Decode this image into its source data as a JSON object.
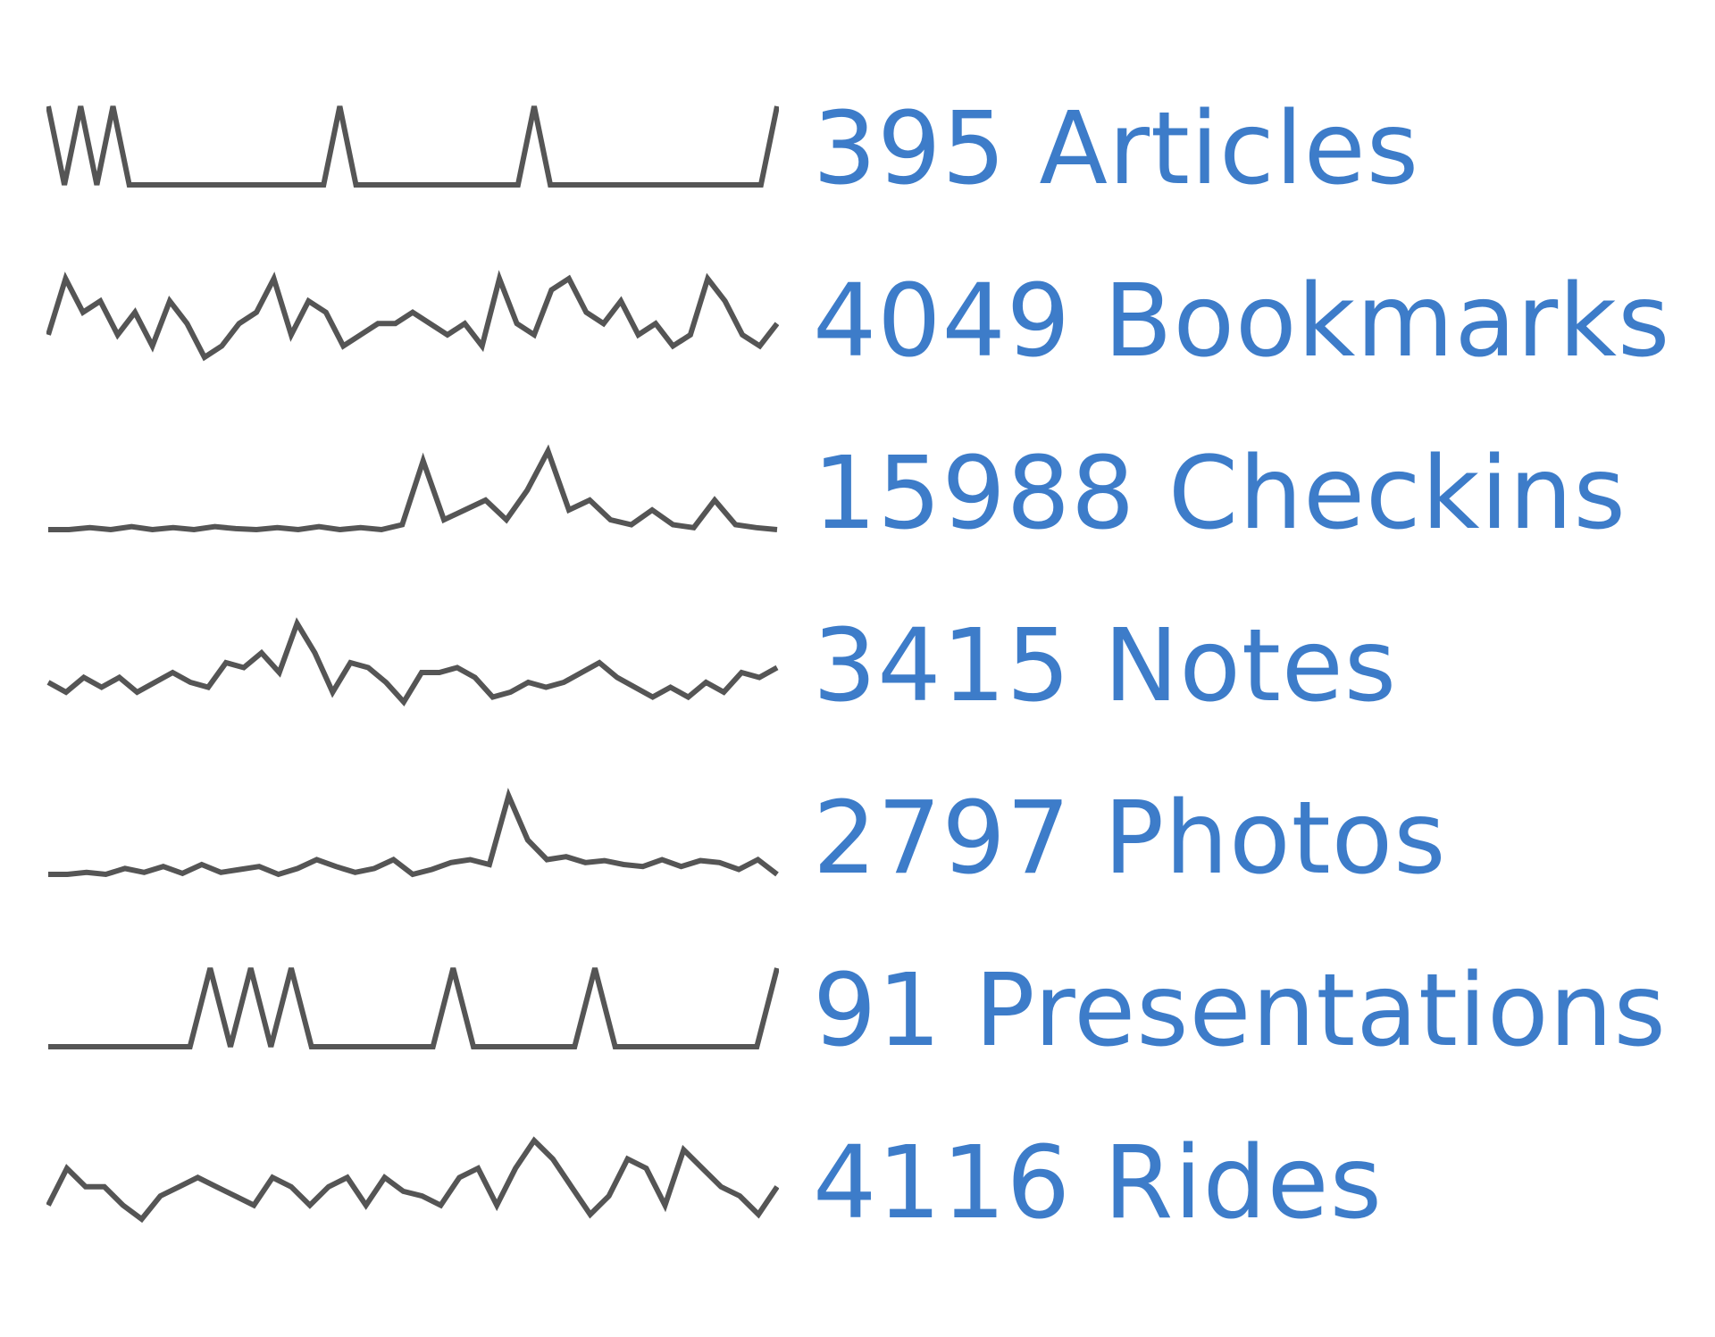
{
  "colors": {
    "link": "#3d7cc9",
    "sparkline": "#555555"
  },
  "stats": [
    {
      "count": "395",
      "label": "Articles"
    },
    {
      "count": "4049",
      "label": "Bookmarks"
    },
    {
      "count": "15988",
      "label": "Checkins"
    },
    {
      "count": "3415",
      "label": "Notes"
    },
    {
      "count": "2797",
      "label": "Photos"
    },
    {
      "count": "91",
      "label": "Presentations"
    },
    {
      "count": "4116",
      "label": "Rides"
    }
  ],
  "chart_data": [
    {
      "type": "line",
      "series": [
        {
          "values": [
            10,
            1,
            10,
            1,
            10,
            1,
            1,
            1,
            1,
            1,
            1,
            1,
            1,
            1,
            1,
            1,
            1,
            1,
            10,
            1,
            1,
            1,
            1,
            1,
            1,
            1,
            1,
            1,
            1,
            1,
            10,
            1,
            1,
            1,
            1,
            1,
            1,
            1,
            1,
            1,
            1,
            1,
            1,
            1,
            1,
            10
          ]
        }
      ]
    },
    {
      "type": "line",
      "series": [
        {
          "values": [
            3,
            8,
            5,
            6,
            3,
            5,
            2,
            6,
            4,
            1,
            2,
            4,
            5,
            8,
            3,
            6,
            5,
            2,
            3,
            4,
            4,
            5,
            4,
            3,
            4,
            2,
            8,
            4,
            3,
            7,
            8,
            5,
            4,
            6,
            3,
            4,
            2,
            3,
            8,
            6,
            3,
            2,
            4
          ]
        }
      ]
    },
    {
      "type": "line",
      "series": [
        {
          "values": [
            1,
            1,
            1.2,
            1,
            1.3,
            1,
            1.2,
            1,
            1.3,
            1.1,
            1,
            1.2,
            1,
            1.3,
            1,
            1.2,
            1,
            1.5,
            8,
            2,
            3,
            4,
            2,
            5,
            9,
            3,
            4,
            2,
            1.5,
            3,
            1.5,
            1.2,
            4,
            1.5,
            1.2,
            1
          ]
        }
      ]
    },
    {
      "type": "line",
      "series": [
        {
          "values": [
            3,
            2,
            3.5,
            2.5,
            3.5,
            2,
            3,
            4,
            3,
            2.5,
            5,
            4.5,
            6,
            4,
            9,
            6,
            2,
            5,
            4.5,
            3,
            1,
            4,
            4,
            4.5,
            3.5,
            1.5,
            2,
            3,
            2.5,
            3,
            4,
            5,
            3.5,
            2.5,
            1.5,
            2.5,
            1.5,
            3,
            2,
            4,
            3.5,
            4.5
          ]
        }
      ]
    },
    {
      "type": "line",
      "series": [
        {
          "values": [
            1,
            1,
            1.2,
            1,
            1.6,
            1.2,
            1.8,
            1.1,
            2,
            1.2,
            1.5,
            1.8,
            1,
            1.6,
            2.5,
            1.8,
            1.2,
            1.6,
            2.5,
            1,
            1.5,
            2.2,
            2.5,
            2,
            9,
            4.5,
            2.5,
            2.8,
            2.2,
            2.4,
            2,
            1.8,
            2.5,
            1.8,
            2.4,
            2.2,
            1.5,
            2.5,
            1
          ]
        }
      ]
    },
    {
      "type": "line",
      "series": [
        {
          "values": [
            1,
            1,
            1,
            1,
            1,
            1,
            1,
            1,
            10,
            1,
            10,
            1,
            10,
            1,
            1,
            1,
            1,
            1,
            1,
            1,
            10,
            1,
            1,
            1,
            1,
            1,
            1,
            10,
            1,
            1,
            1,
            1,
            1,
            1,
            1,
            1,
            10
          ]
        }
      ]
    },
    {
      "type": "line",
      "series": [
        {
          "values": [
            3,
            7,
            5,
            5,
            3,
            1.5,
            4,
            5,
            6,
            5,
            4,
            3,
            6,
            5,
            3,
            5,
            6,
            3,
            6,
            4.5,
            4,
            3,
            6,
            7,
            3,
            7,
            10,
            8,
            5,
            2,
            4,
            8,
            7,
            3,
            9,
            7,
            5,
            4,
            2,
            5
          ]
        }
      ]
    }
  ]
}
